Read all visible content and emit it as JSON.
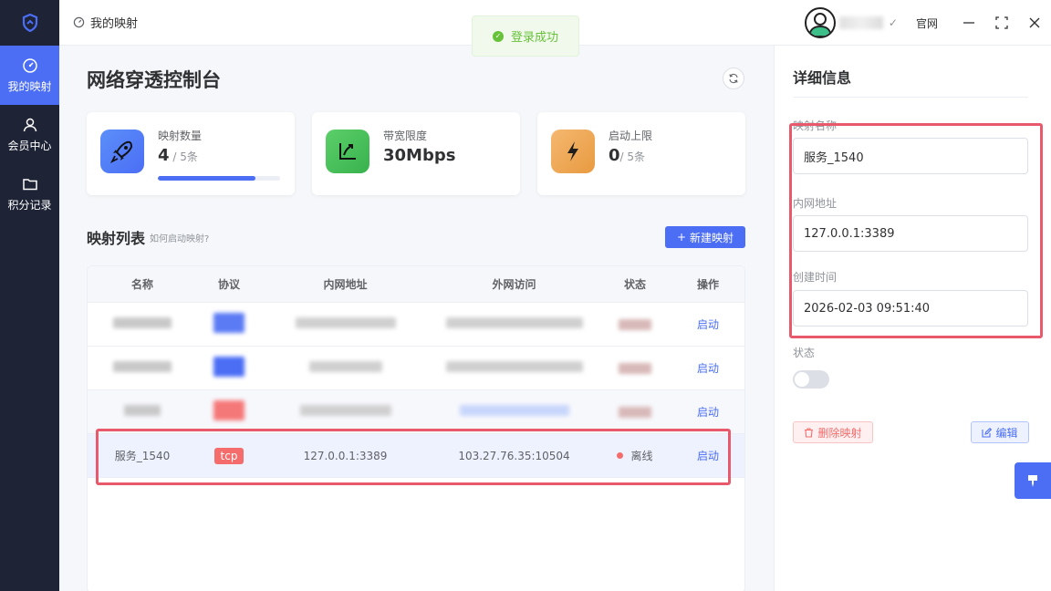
{
  "sidebar": {
    "items": [
      {
        "label": "我的映射",
        "icon": "dashboard-icon",
        "active": true
      },
      {
        "label": "会员中心",
        "icon": "user-icon",
        "active": false
      },
      {
        "label": "积分记录",
        "icon": "folder-icon",
        "active": false
      }
    ]
  },
  "titlebar": {
    "breadcrumb": "我的映射",
    "site_link": "官网"
  },
  "toast": {
    "message": "登录成功"
  },
  "main": {
    "title": "网络穿透控制台",
    "stats": [
      {
        "label": "映射数量",
        "value": "4",
        "unit": " / 5条",
        "progress": 0.8
      },
      {
        "label": "带宽限度",
        "value": "30Mbps",
        "unit": ""
      },
      {
        "label": "启动上限",
        "value": "0",
        "unit": "/ 5条"
      }
    ],
    "list_title": "映射列表",
    "list_hint": "如何启动映射?",
    "new_button": "新建映射",
    "table": {
      "headers": [
        "名称",
        "协议",
        "内网地址",
        "外网访问",
        "状态",
        "操作"
      ],
      "rows": [
        {
          "action": "启动"
        },
        {
          "action": "启动"
        },
        {
          "action": "启动"
        },
        {
          "name": "服务_1540",
          "protocol": "tcp",
          "local": "127.0.0.1:3389",
          "remote": "103.27.76.35:10504",
          "status": "离线",
          "action": "启动"
        }
      ]
    }
  },
  "detail": {
    "title": "详细信息",
    "name_label": "映射名称",
    "name_value": "服务_1540",
    "local_label": "内网地址",
    "local_value": "127.0.0.1:3389",
    "created_label": "创建时间",
    "created_value": "2026-02-03 09:51:40",
    "status_label": "状态",
    "delete_button": "删除映射",
    "edit_button": "编辑"
  },
  "colors": {
    "primary": "#4b6ef5",
    "sidebar": "#1e2335",
    "danger": "#f56c6c",
    "success": "#67c23a",
    "highlight": "#e8596b"
  }
}
